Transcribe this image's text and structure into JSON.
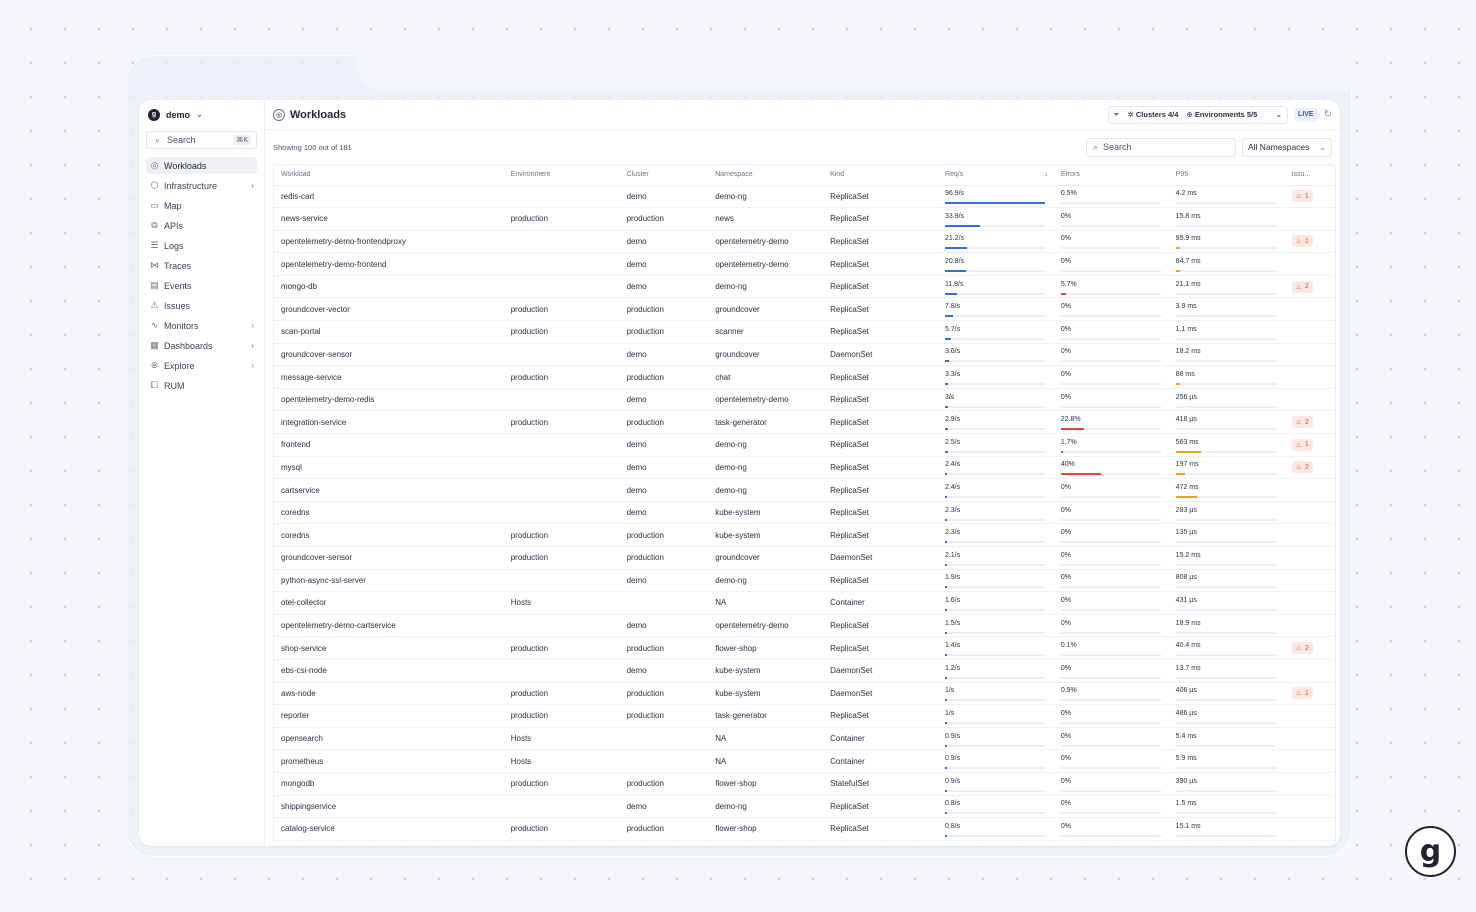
{
  "sidebar": {
    "org": "demo",
    "search_placeholder": "Search",
    "search_shortcut": "⌘K",
    "items": [
      {
        "label": "Workloads",
        "icon": "workloads-icon",
        "glyph": "◎",
        "active": true,
        "caret": false
      },
      {
        "label": "Infrastructure",
        "icon": "infrastructure-icon",
        "glyph": "⬡",
        "active": false,
        "caret": true
      },
      {
        "label": "Map",
        "icon": "map-icon",
        "glyph": "▭",
        "active": false,
        "caret": false
      },
      {
        "label": "APIs",
        "icon": "apis-icon",
        "glyph": "⧉",
        "active": false,
        "caret": false
      },
      {
        "label": "Logs",
        "icon": "logs-icon",
        "glyph": "☰",
        "active": false,
        "caret": false
      },
      {
        "label": "Traces",
        "icon": "traces-icon",
        "glyph": "⋈",
        "active": false,
        "caret": false
      },
      {
        "label": "Events",
        "icon": "events-icon",
        "glyph": "▤",
        "active": false,
        "caret": false
      },
      {
        "label": "Issues",
        "icon": "issues-icon",
        "glyph": "⚠",
        "active": false,
        "caret": false
      },
      {
        "label": "Monitors",
        "icon": "monitors-icon",
        "glyph": "∿",
        "active": false,
        "caret": true
      },
      {
        "label": "Dashboards",
        "icon": "dashboards-icon",
        "glyph": "▦",
        "active": false,
        "caret": true
      },
      {
        "label": "Explore",
        "icon": "explore-icon",
        "glyph": "⊛",
        "active": false,
        "caret": true
      },
      {
        "label": "RUM",
        "icon": "rum-icon",
        "glyph": "⧠",
        "active": false,
        "caret": false
      }
    ]
  },
  "header": {
    "title": "Workloads",
    "clusters": "Clusters 4/4",
    "environments": "Environments 5/5",
    "live": "LIVE"
  },
  "toolbar": {
    "showing": "Showing 100 out of 181",
    "search_placeholder": "Search",
    "namespace": "All Namespaces"
  },
  "colors": {
    "reqs_bar": "#2f6fdb",
    "errors_bar": "#e0473a",
    "p95_bar": "#f0a020",
    "issue": "#e0502f"
  },
  "table": {
    "columns": [
      "Workload",
      "Environment",
      "Cluster",
      "Namespace",
      "Kind",
      "Req/s",
      "Errors",
      "P95",
      "Issu..."
    ],
    "rows": [
      {
        "workload": "redis-cart",
        "environment": "",
        "cluster": "demo",
        "namespace": "demo-ng",
        "kind": "ReplicaSet",
        "reqs": "96.9/s",
        "reqs_frac": 1.0,
        "errors": "0.5%",
        "errors_frac": 0.0,
        "p95": "4.2 ms",
        "p95_frac": 0.0,
        "issues": "1"
      },
      {
        "workload": "news-service",
        "environment": "production",
        "cluster": "production",
        "namespace": "news",
        "kind": "ReplicaSet",
        "reqs": "33.9/s",
        "reqs_frac": 0.35,
        "errors": "0%",
        "errors_frac": 0.0,
        "p95": "15.8 ms",
        "p95_frac": 0.0,
        "issues": ""
      },
      {
        "workload": "opentelemetry-demo-frontendproxy",
        "environment": "",
        "cluster": "demo",
        "namespace": "opentelemetry-demo",
        "kind": "ReplicaSet",
        "reqs": "21.2/s",
        "reqs_frac": 0.22,
        "errors": "0%",
        "errors_frac": 0.0,
        "p95": "95.9 ms",
        "p95_frac": 0.04,
        "issues": "1"
      },
      {
        "workload": "opentelemetry-demo-frontend",
        "environment": "",
        "cluster": "demo",
        "namespace": "opentelemetry-demo",
        "kind": "ReplicaSet",
        "reqs": "20.8/s",
        "reqs_frac": 0.21,
        "errors": "0%",
        "errors_frac": 0.0,
        "p95": "84.7 ms",
        "p95_frac": 0.04,
        "issues": ""
      },
      {
        "workload": "mongo-db",
        "environment": "",
        "cluster": "demo",
        "namespace": "demo-ng",
        "kind": "ReplicaSet",
        "reqs": "11.8/s",
        "reqs_frac": 0.12,
        "errors": "5.7%",
        "errors_frac": 0.05,
        "p95": "21.1 ms",
        "p95_frac": 0.0,
        "issues": "2"
      },
      {
        "workload": "groundcover-vector",
        "environment": "production",
        "cluster": "production",
        "namespace": "groundcover",
        "kind": "ReplicaSet",
        "reqs": "7.8/s",
        "reqs_frac": 0.08,
        "errors": "0%",
        "errors_frac": 0.0,
        "p95": "3.9 ms",
        "p95_frac": 0.0,
        "issues": ""
      },
      {
        "workload": "scan-portal",
        "environment": "production",
        "cluster": "production",
        "namespace": "scanner",
        "kind": "ReplicaSet",
        "reqs": "5.7/s",
        "reqs_frac": 0.06,
        "errors": "0%",
        "errors_frac": 0.0,
        "p95": "1.1 ms",
        "p95_frac": 0.0,
        "issues": ""
      },
      {
        "workload": "groundcover-sensor",
        "environment": "",
        "cluster": "demo",
        "namespace": "groundcover",
        "kind": "DaemonSet",
        "reqs": "3.6/s",
        "reqs_frac": 0.04,
        "errors": "0%",
        "errors_frac": 0.0,
        "p95": "18.2 ms",
        "p95_frac": 0.0,
        "issues": ""
      },
      {
        "workload": "message-service",
        "environment": "production",
        "cluster": "production",
        "namespace": "chat",
        "kind": "ReplicaSet",
        "reqs": "3.3/s",
        "reqs_frac": 0.03,
        "errors": "0%",
        "errors_frac": 0.0,
        "p95": "88 ms",
        "p95_frac": 0.04,
        "issues": ""
      },
      {
        "workload": "opentelemetry-demo-redis",
        "environment": "",
        "cluster": "demo",
        "namespace": "opentelemetry-demo",
        "kind": "ReplicaSet",
        "reqs": "3/s",
        "reqs_frac": 0.03,
        "errors": "0%",
        "errors_frac": 0.0,
        "p95": "256 µs",
        "p95_frac": 0.0,
        "issues": ""
      },
      {
        "workload": "integration-service",
        "environment": "production",
        "cluster": "production",
        "namespace": "task-generator",
        "kind": "ReplicaSet",
        "reqs": "2.9/s",
        "reqs_frac": 0.03,
        "errors": "22.8%",
        "errors_frac": 0.23,
        "p95": "418 µs",
        "p95_frac": 0.0,
        "issues": "2"
      },
      {
        "workload": "frontend",
        "environment": "",
        "cluster": "demo",
        "namespace": "demo-ng",
        "kind": "ReplicaSet",
        "reqs": "2.5/s",
        "reqs_frac": 0.03,
        "errors": "1.7%",
        "errors_frac": 0.02,
        "p95": "563 ms",
        "p95_frac": 0.25,
        "issues": "1"
      },
      {
        "workload": "mysql",
        "environment": "",
        "cluster": "demo",
        "namespace": "demo-ng",
        "kind": "ReplicaSet",
        "reqs": "2.4/s",
        "reqs_frac": 0.02,
        "errors": "40%",
        "errors_frac": 0.4,
        "p95": "197 ms",
        "p95_frac": 0.09,
        "issues": "2"
      },
      {
        "workload": "cartservice",
        "environment": "",
        "cluster": "demo",
        "namespace": "demo-ng",
        "kind": "ReplicaSet",
        "reqs": "2.4/s",
        "reqs_frac": 0.02,
        "errors": "0%",
        "errors_frac": 0.0,
        "p95": "472 ms",
        "p95_frac": 0.21,
        "issues": ""
      },
      {
        "workload": "coredns",
        "environment": "",
        "cluster": "demo",
        "namespace": "kube-system",
        "kind": "ReplicaSet",
        "reqs": "2.3/s",
        "reqs_frac": 0.02,
        "errors": "0%",
        "errors_frac": 0.0,
        "p95": "283 µs",
        "p95_frac": 0.0,
        "issues": ""
      },
      {
        "workload": "coredns",
        "environment": "production",
        "cluster": "production",
        "namespace": "kube-system",
        "kind": "ReplicaSet",
        "reqs": "2.3/s",
        "reqs_frac": 0.02,
        "errors": "0%",
        "errors_frac": 0.0,
        "p95": "135 µs",
        "p95_frac": 0.0,
        "issues": ""
      },
      {
        "workload": "groundcover-sensor",
        "environment": "production",
        "cluster": "production",
        "namespace": "groundcover",
        "kind": "DaemonSet",
        "reqs": "2.1/s",
        "reqs_frac": 0.02,
        "errors": "0%",
        "errors_frac": 0.0,
        "p95": "15.2 ms",
        "p95_frac": 0.0,
        "issues": ""
      },
      {
        "workload": "python-async-ssl-server",
        "environment": "",
        "cluster": "demo",
        "namespace": "demo-ng",
        "kind": "ReplicaSet",
        "reqs": "1.9/s",
        "reqs_frac": 0.02,
        "errors": "0%",
        "errors_frac": 0.0,
        "p95": "808 µs",
        "p95_frac": 0.0,
        "issues": ""
      },
      {
        "workload": "otel-collector",
        "environment": "Hosts",
        "cluster": "",
        "namespace": "NA",
        "kind": "Container",
        "reqs": "1.6/s",
        "reqs_frac": 0.02,
        "errors": "0%",
        "errors_frac": 0.0,
        "p95": "431 µs",
        "p95_frac": 0.0,
        "issues": ""
      },
      {
        "workload": "opentelemetry-demo-cartservice",
        "environment": "",
        "cluster": "demo",
        "namespace": "opentelemetry-demo",
        "kind": "ReplicaSet",
        "reqs": "1.5/s",
        "reqs_frac": 0.02,
        "errors": "0%",
        "errors_frac": 0.0,
        "p95": "18.9 ms",
        "p95_frac": 0.0,
        "issues": ""
      },
      {
        "workload": "shop-service",
        "environment": "production",
        "cluster": "production",
        "namespace": "flower-shop",
        "kind": "ReplicaSet",
        "reqs": "1.4/s",
        "reqs_frac": 0.01,
        "errors": "0.1%",
        "errors_frac": 0.0,
        "p95": "40.4 ms",
        "p95_frac": 0.0,
        "issues": "2"
      },
      {
        "workload": "ebs-csi-node",
        "environment": "",
        "cluster": "demo",
        "namespace": "kube-system",
        "kind": "DaemonSet",
        "reqs": "1.2/s",
        "reqs_frac": 0.01,
        "errors": "0%",
        "errors_frac": 0.0,
        "p95": "13.7 ms",
        "p95_frac": 0.0,
        "issues": ""
      },
      {
        "workload": "aws-node",
        "environment": "production",
        "cluster": "production",
        "namespace": "kube-system",
        "kind": "DaemonSet",
        "reqs": "1/s",
        "reqs_frac": 0.01,
        "errors": "0.9%",
        "errors_frac": 0.0,
        "p95": "406 µs",
        "p95_frac": 0.0,
        "issues": "1"
      },
      {
        "workload": "reporter",
        "environment": "production",
        "cluster": "production",
        "namespace": "task-generator",
        "kind": "ReplicaSet",
        "reqs": "1/s",
        "reqs_frac": 0.01,
        "errors": "0%",
        "errors_frac": 0.0,
        "p95": "486 µs",
        "p95_frac": 0.0,
        "issues": ""
      },
      {
        "workload": "opensearch",
        "environment": "Hosts",
        "cluster": "",
        "namespace": "NA",
        "kind": "Container",
        "reqs": "0.9/s",
        "reqs_frac": 0.01,
        "errors": "0%",
        "errors_frac": 0.0,
        "p95": "5.4 ms",
        "p95_frac": 0.0,
        "issues": ""
      },
      {
        "workload": "prometheus",
        "environment": "Hosts",
        "cluster": "",
        "namespace": "NA",
        "kind": "Container",
        "reqs": "0.9/s",
        "reqs_frac": 0.01,
        "errors": "0%",
        "errors_frac": 0.0,
        "p95": "5.9 ms",
        "p95_frac": 0.0,
        "issues": ""
      },
      {
        "workload": "mongodb",
        "environment": "production",
        "cluster": "production",
        "namespace": "flower-shop",
        "kind": "StatefulSet",
        "reqs": "0.9/s",
        "reqs_frac": 0.01,
        "errors": "0%",
        "errors_frac": 0.0,
        "p95": "390 µs",
        "p95_frac": 0.0,
        "issues": ""
      },
      {
        "workload": "shippingservice",
        "environment": "",
        "cluster": "demo",
        "namespace": "demo-ng",
        "kind": "ReplicaSet",
        "reqs": "0.8/s",
        "reqs_frac": 0.01,
        "errors": "0%",
        "errors_frac": 0.0,
        "p95": "1.5 ms",
        "p95_frac": 0.0,
        "issues": ""
      },
      {
        "workload": "catalog-service",
        "environment": "production",
        "cluster": "production",
        "namespace": "flower-shop",
        "kind": "ReplicaSet",
        "reqs": "0.8/s",
        "reqs_frac": 0.01,
        "errors": "0%",
        "errors_frac": 0.0,
        "p95": "15.1 ms",
        "p95_frac": 0.0,
        "issues": ""
      }
    ]
  },
  "brand_logo": "g"
}
